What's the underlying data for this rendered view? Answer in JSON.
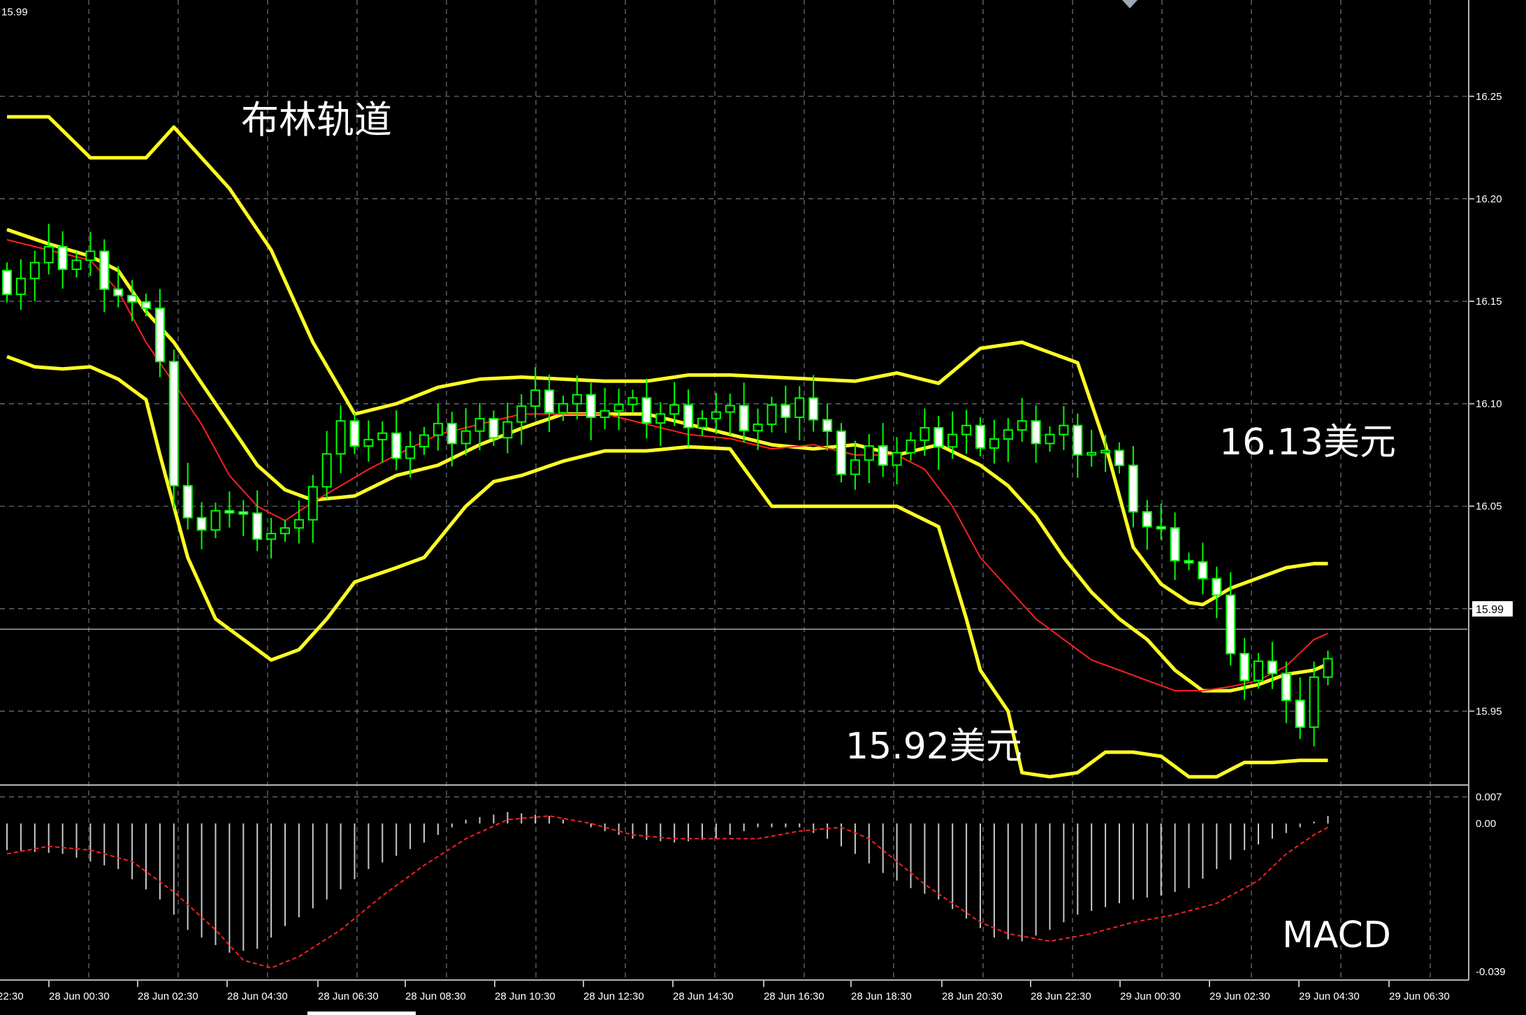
{
  "price_badge": "15.99",
  "corner_label": "15.99",
  "annotations": {
    "bollinger": "布林轨道",
    "upper_note": "16.13美元",
    "lower_note": "15.92美元",
    "macd": "MACD"
  },
  "colors": {
    "background": "#000000",
    "grid": "#6e7680",
    "bollinger": "#ffff24",
    "ma": "#ff2020",
    "candle": "#00ff00",
    "candle_body_up": "#000000",
    "candle_body_down": "#ffffff",
    "macd_hist": "#c8c8c8",
    "macd_signal": "#ff2020",
    "current_price_line": "#9aa8b8"
  },
  "chart_data": [
    {
      "type": "candlestick",
      "price_axis": {
        "ticks": [
          "16.25",
          "16.20",
          "16.15",
          "16.10",
          "16.05",
          "16.00",
          "15.95"
        ],
        "range": [
          15.915,
          16.297
        ],
        "current_price": 15.99
      },
      "time_axis": {
        "labels": [
          "22:30",
          "28 Jun 00:30",
          "28 Jun 02:30",
          "28 Jun 04:30",
          "28 Jun 06:30",
          "28 Jun 08:30",
          "28 Jun 10:30",
          "28 Jun 12:30",
          "28 Jun 14:30",
          "28 Jun 16:30",
          "28 Jun 18:30",
          "28 Jun 20:30",
          "28 Jun 22:30",
          "29 Jun 00:30",
          "29 Jun 02:30",
          "29 Jun 04:30",
          "29 Jun 06:30"
        ]
      },
      "bar_count": 96,
      "key_closes": [
        [
          0,
          16.16
        ],
        [
          3,
          16.17
        ],
        [
          6,
          16.17
        ],
        [
          8,
          16.155
        ],
        [
          10,
          16.14
        ],
        [
          11,
          16.125
        ],
        [
          12,
          16.06
        ],
        [
          13,
          16.04
        ],
        [
          15,
          16.05
        ],
        [
          17,
          16.04
        ],
        [
          20,
          16.035
        ],
        [
          21,
          16.05
        ],
        [
          24,
          16.085
        ],
        [
          28,
          16.08
        ],
        [
          32,
          16.085
        ],
        [
          35,
          16.09
        ],
        [
          38,
          16.1
        ],
        [
          42,
          16.1
        ],
        [
          46,
          16.095
        ],
        [
          50,
          16.095
        ],
        [
          54,
          16.09
        ],
        [
          57,
          16.105
        ],
        [
          58,
          16.09
        ],
        [
          60,
          16.07
        ],
        [
          62,
          16.075
        ],
        [
          65,
          16.08
        ],
        [
          68,
          16.085
        ],
        [
          72,
          16.085
        ],
        [
          76,
          16.085
        ],
        [
          79,
          16.075
        ],
        [
          82,
          16.04
        ],
        [
          85,
          16.025
        ],
        [
          87,
          16.0
        ],
        [
          89,
          15.965
        ],
        [
          91,
          15.975
        ],
        [
          93,
          15.94
        ],
        [
          95,
          15.98
        ]
      ],
      "series": [
        {
          "name": "upper",
          "points": [
            [
              0,
              16.24
            ],
            [
              3,
              16.24
            ],
            [
              6,
              16.22
            ],
            [
              8,
              16.22
            ],
            [
              10,
              16.22
            ],
            [
              12,
              16.235
            ],
            [
              14,
              16.22
            ],
            [
              16,
              16.205
            ],
            [
              19,
              16.175
            ],
            [
              22,
              16.13
            ],
            [
              25,
              16.095
            ],
            [
              28,
              16.1
            ],
            [
              31,
              16.108
            ],
            [
              34,
              16.112
            ],
            [
              37,
              16.113
            ],
            [
              40,
              16.112
            ],
            [
              43,
              16.111
            ],
            [
              46,
              16.111
            ],
            [
              49,
              16.114
            ],
            [
              52,
              16.114
            ],
            [
              55,
              16.113
            ],
            [
              58,
              16.112
            ],
            [
              61,
              16.111
            ],
            [
              64,
              16.115
            ],
            [
              67,
              16.11
            ],
            [
              70,
              16.127
            ],
            [
              73,
              16.13
            ],
            [
              75,
              16.125
            ],
            [
              77,
              16.12
            ],
            [
              79,
              16.08
            ],
            [
              81,
              16.03
            ],
            [
              83,
              16.012
            ],
            [
              85,
              16.003
            ],
            [
              86,
              16.002
            ],
            [
              88,
              16.01
            ],
            [
              90,
              16.015
            ],
            [
              92,
              16.02
            ],
            [
              94,
              16.022
            ]
          ]
        },
        {
          "name": "middle",
          "points": [
            [
              0,
              16.185
            ],
            [
              3,
              16.178
            ],
            [
              6,
              16.172
            ],
            [
              8,
              16.165
            ],
            [
              10,
              16.145
            ],
            [
              12,
              16.13
            ],
            [
              14,
              16.11
            ],
            [
              16,
              16.09
            ],
            [
              18,
              16.07
            ],
            [
              20,
              16.058
            ],
            [
              22,
              16.053
            ],
            [
              25,
              16.055
            ],
            [
              28,
              16.065
            ],
            [
              31,
              16.07
            ],
            [
              34,
              16.08
            ],
            [
              37,
              16.088
            ],
            [
              40,
              16.095
            ],
            [
              43,
              16.095
            ],
            [
              46,
              16.095
            ],
            [
              49,
              16.09
            ],
            [
              52,
              16.085
            ],
            [
              55,
              16.08
            ],
            [
              58,
              16.078
            ],
            [
              61,
              16.08
            ],
            [
              64,
              16.075
            ],
            [
              67,
              16.08
            ],
            [
              70,
              16.07
            ],
            [
              72,
              16.06
            ],
            [
              74,
              16.045
            ],
            [
              76,
              16.025
            ],
            [
              78,
              16.008
            ],
            [
              80,
              15.995
            ],
            [
              82,
              15.985
            ],
            [
              84,
              15.97
            ],
            [
              86,
              15.96
            ],
            [
              88,
              15.96
            ],
            [
              90,
              15.963
            ],
            [
              92,
              15.968
            ],
            [
              94,
              15.97
            ],
            [
              95,
              15.973
            ]
          ]
        },
        {
          "name": "lower",
          "points": [
            [
              0,
              16.123
            ],
            [
              2,
              16.118
            ],
            [
              4,
              16.117
            ],
            [
              6,
              16.118
            ],
            [
              8,
              16.112
            ],
            [
              10,
              16.102
            ],
            [
              11,
              16.075
            ],
            [
              13,
              16.025
            ],
            [
              15,
              15.995
            ],
            [
              17,
              15.985
            ],
            [
              19,
              15.975
            ],
            [
              21,
              15.98
            ],
            [
              23,
              15.995
            ],
            [
              25,
              16.013
            ],
            [
              28,
              16.02
            ],
            [
              30,
              16.025
            ],
            [
              33,
              16.05
            ],
            [
              35,
              16.062
            ],
            [
              37,
              16.065
            ],
            [
              40,
              16.072
            ],
            [
              43,
              16.077
            ],
            [
              46,
              16.077
            ],
            [
              49,
              16.079
            ],
            [
              52,
              16.078
            ],
            [
              55,
              16.05
            ],
            [
              58,
              16.05
            ],
            [
              61,
              16.05
            ],
            [
              64,
              16.05
            ],
            [
              67,
              16.04
            ],
            [
              69,
              15.995
            ],
            [
              70,
              15.97
            ],
            [
              72,
              15.95
            ],
            [
              73,
              15.92
            ],
            [
              75,
              15.918
            ],
            [
              77,
              15.92
            ],
            [
              79,
              15.93
            ],
            [
              81,
              15.93
            ],
            [
              83,
              15.928
            ],
            [
              85,
              15.918
            ],
            [
              87,
              15.918
            ],
            [
              89,
              15.925
            ],
            [
              91,
              15.925
            ],
            [
              93,
              15.926
            ],
            [
              95,
              15.926
            ]
          ]
        },
        {
          "name": "ma",
          "points": [
            [
              0,
              16.18
            ],
            [
              3,
              16.175
            ],
            [
              6,
              16.17
            ],
            [
              8,
              16.155
            ],
            [
              10,
              16.13
            ],
            [
              12,
              16.11
            ],
            [
              14,
              16.09
            ],
            [
              16,
              16.065
            ],
            [
              18,
              16.05
            ],
            [
              20,
              16.043
            ],
            [
              22,
              16.052
            ],
            [
              24,
              16.06
            ],
            [
              26,
              16.068
            ],
            [
              28,
              16.075
            ],
            [
              31,
              16.085
            ],
            [
              34,
              16.09
            ],
            [
              37,
              16.095
            ],
            [
              40,
              16.095
            ],
            [
              43,
              16.095
            ],
            [
              46,
              16.09
            ],
            [
              49,
              16.085
            ],
            [
              52,
              16.083
            ],
            [
              55,
              16.078
            ],
            [
              58,
              16.08
            ],
            [
              61,
              16.075
            ],
            [
              64,
              16.075
            ],
            [
              66,
              16.068
            ],
            [
              68,
              16.05
            ],
            [
              70,
              16.025
            ],
            [
              72,
              16.01
            ],
            [
              74,
              15.995
            ],
            [
              76,
              15.985
            ],
            [
              78,
              15.975
            ],
            [
              80,
              15.97
            ],
            [
              82,
              15.965
            ],
            [
              84,
              15.96
            ],
            [
              86,
              15.96
            ],
            [
              88,
              15.962
            ],
            [
              90,
              15.965
            ],
            [
              92,
              15.972
            ],
            [
              94,
              15.985
            ],
            [
              95,
              15.988
            ]
          ]
        }
      ]
    },
    {
      "type": "bar",
      "name": "MACD",
      "y_ticks": [
        "0.007",
        "0.00",
        "-0.039"
      ],
      "ylim": [
        -0.039,
        0.007
      ],
      "histogram_points": [
        [
          0,
          -0.007
        ],
        [
          4,
          -0.008
        ],
        [
          8,
          -0.012
        ],
        [
          11,
          -0.02
        ],
        [
          13,
          -0.028
        ],
        [
          16,
          -0.034
        ],
        [
          18,
          -0.033
        ],
        [
          20,
          -0.027
        ],
        [
          23,
          -0.02
        ],
        [
          26,
          -0.012
        ],
        [
          30,
          -0.005
        ],
        [
          33,
          0.001
        ],
        [
          36,
          0.003
        ],
        [
          39,
          0.002
        ],
        [
          42,
          -0.001
        ],
        [
          45,
          -0.004
        ],
        [
          48,
          -0.005
        ],
        [
          51,
          -0.004
        ],
        [
          54,
          -0.001
        ],
        [
          57,
          -0.001
        ],
        [
          59,
          -0.004
        ],
        [
          61,
          -0.008
        ],
        [
          63,
          -0.013
        ],
        [
          65,
          -0.017
        ],
        [
          67,
          -0.02
        ],
        [
          69,
          -0.025
        ],
        [
          71,
          -0.03
        ],
        [
          73,
          -0.031
        ],
        [
          75,
          -0.028
        ],
        [
          77,
          -0.024
        ],
        [
          79,
          -0.022
        ],
        [
          81,
          -0.02
        ],
        [
          83,
          -0.019
        ],
        [
          85,
          -0.017
        ],
        [
          87,
          -0.012
        ],
        [
          89,
          -0.007
        ],
        [
          91,
          -0.004
        ],
        [
          93,
          -0.001
        ],
        [
          95,
          0.002
        ]
      ],
      "signal_points": [
        [
          0,
          -0.008
        ],
        [
          3,
          -0.006
        ],
        [
          6,
          -0.007
        ],
        [
          9,
          -0.01
        ],
        [
          12,
          -0.018
        ],
        [
          15,
          -0.028
        ],
        [
          17,
          -0.036
        ],
        [
          19,
          -0.038
        ],
        [
          21,
          -0.035
        ],
        [
          24,
          -0.028
        ],
        [
          27,
          -0.019
        ],
        [
          30,
          -0.011
        ],
        [
          33,
          -0.004
        ],
        [
          36,
          0.001
        ],
        [
          39,
          0.002
        ],
        [
          42,
          0.0
        ],
        [
          45,
          -0.003
        ],
        [
          48,
          -0.004
        ],
        [
          51,
          -0.004
        ],
        [
          54,
          -0.004
        ],
        [
          57,
          -0.002
        ],
        [
          60,
          -0.001
        ],
        [
          62,
          -0.004
        ],
        [
          64,
          -0.01
        ],
        [
          66,
          -0.016
        ],
        [
          68,
          -0.021
        ],
        [
          70,
          -0.026
        ],
        [
          72,
          -0.029
        ],
        [
          75,
          -0.031
        ],
        [
          78,
          -0.029
        ],
        [
          81,
          -0.026
        ],
        [
          84,
          -0.024
        ],
        [
          87,
          -0.021
        ],
        [
          90,
          -0.015
        ],
        [
          92,
          -0.008
        ],
        [
          94,
          -0.003
        ],
        [
          95,
          -0.001
        ]
      ]
    }
  ]
}
